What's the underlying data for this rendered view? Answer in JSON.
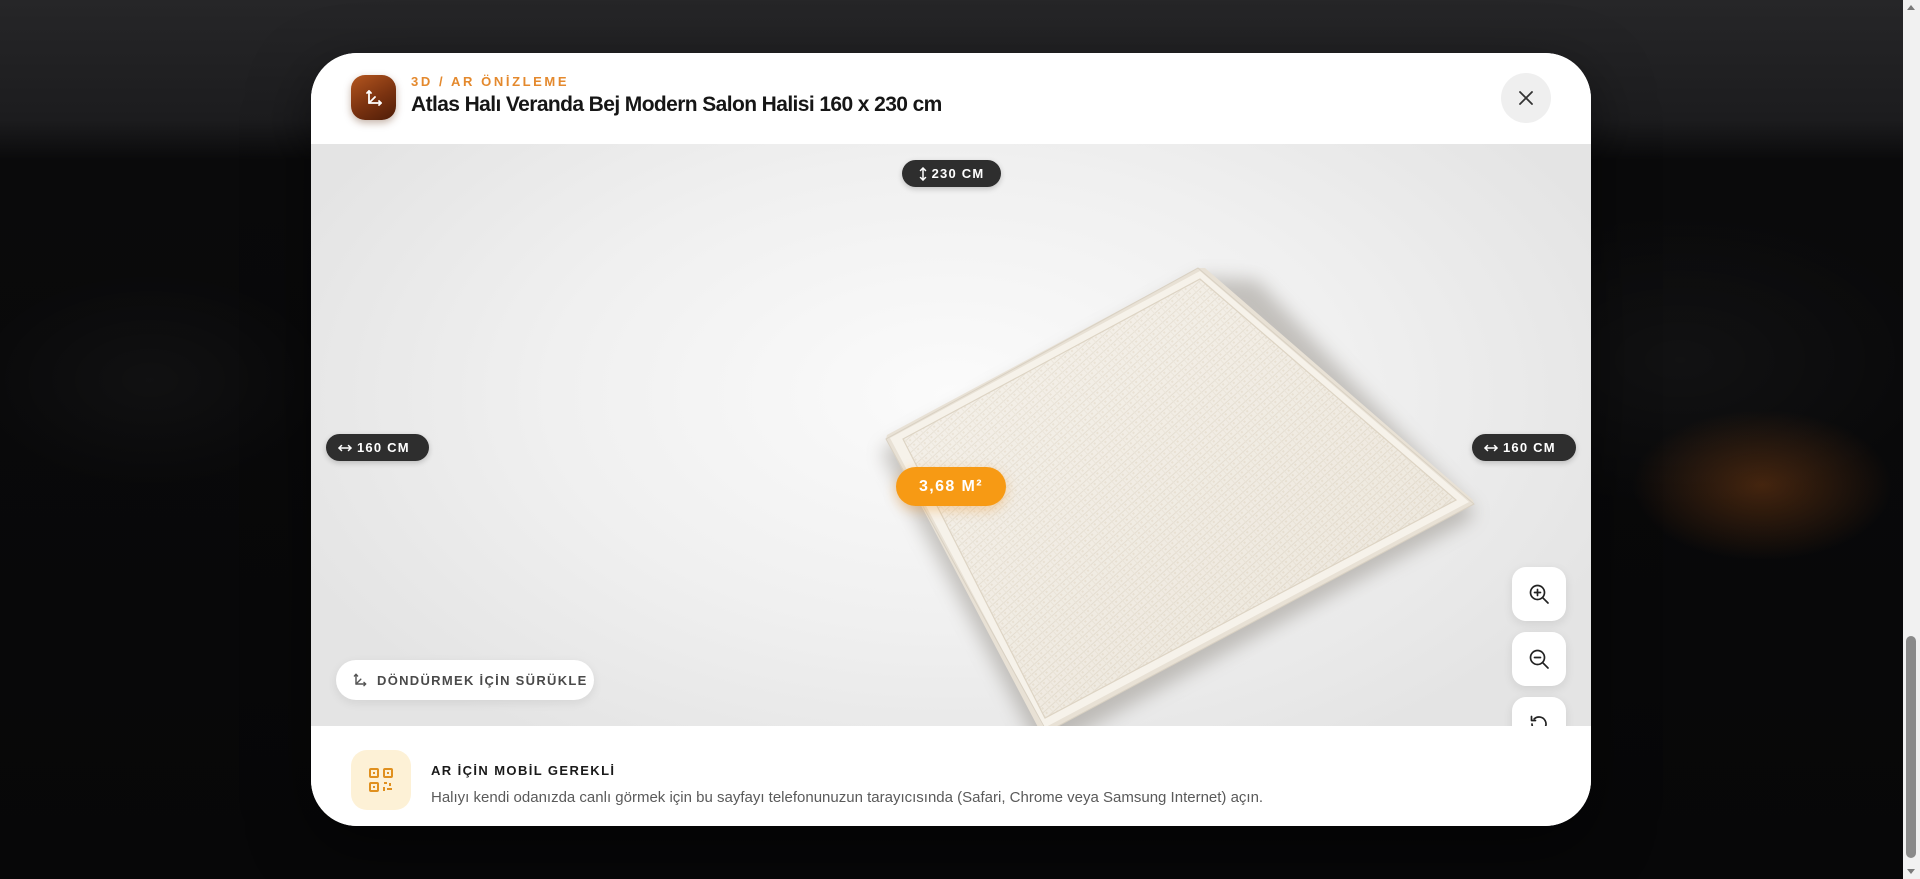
{
  "modal": {
    "eyebrow": "3D / AR ÖNİZLEME",
    "title": "Atlas Halı Veranda Bej Modern Salon Halisi 160 x 230 cm",
    "brand_icon": "rotate-axes-icon",
    "close_icon": "close-icon"
  },
  "viewer": {
    "length_label": "230 CM",
    "width_left_label": "160 CM",
    "width_right_label": "160 CM",
    "area_label": "3,68 M²",
    "drag_hint": "DÖNDÜRMEK İÇİN SÜRÜKLE",
    "controls": {
      "zoom_in_icon": "zoom-in-icon",
      "zoom_out_icon": "zoom-out-icon",
      "reset_icon": "reset-rotation-icon"
    }
  },
  "footer": {
    "heading": "AR İÇİN MOBİL GEREKLİ",
    "text": "Halıyı kendi odanızda canlı görmek için bu sayfayı telefonunuzun tarayıcısında (Safari, Chrome veya Samsung Internet) açın.",
    "icon": "qr-code-icon"
  },
  "colors": {
    "accent": "#f79a14",
    "eyebrow": "#e4892d",
    "brand": "#8a3a12",
    "pill": "#2e2e2e",
    "rug": "#f1ece3"
  }
}
